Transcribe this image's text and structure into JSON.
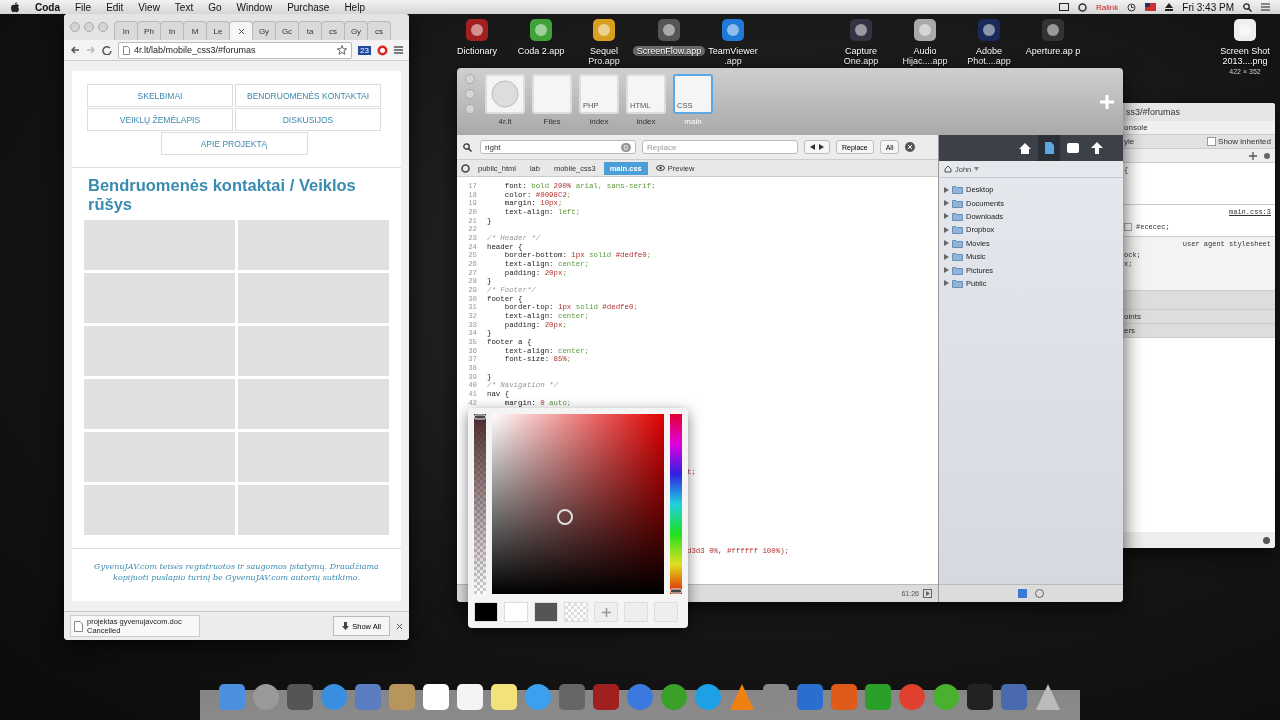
{
  "menubar": {
    "app": "Coda",
    "menus": [
      "File",
      "Edit",
      "View",
      "Text",
      "Go",
      "Window",
      "Purchase",
      "Help"
    ],
    "network": "Ralink",
    "clock": "Fri 3:43 PM"
  },
  "desktop_icons": [
    {
      "label": "Dictionary",
      "selected": false
    },
    {
      "label": "Coda 2.app",
      "selected": false
    },
    {
      "label": "Sequel Pro.app",
      "selected": false
    },
    {
      "label": "ScreenFlow.app",
      "selected": true
    },
    {
      "label": "TeamViewer .app",
      "selected": false
    },
    {
      "label": "Capture One.app",
      "selected": false
    },
    {
      "label": "Audio Hijac....app",
      "selected": false
    },
    {
      "label": "Adobe Phot....app",
      "selected": false
    },
    {
      "label": "Aperture.ap p",
      "selected": false
    },
    {
      "label": "Screen Shot 2013....png",
      "sublabel": "422 × 352",
      "selected": false
    }
  ],
  "browser": {
    "tabs": [
      {
        "label": "In",
        "selected": false
      },
      {
        "label": "Ph",
        "selected": false
      },
      {
        "label": "In",
        "selected": false
      },
      {
        "label": "M",
        "selected": false
      },
      {
        "label": "Le",
        "selected": false
      },
      {
        "selected": true
      },
      {
        "label": "Gy",
        "selected": false
      },
      {
        "label": "Gc",
        "selected": false
      },
      {
        "label": "ta",
        "selected": false
      },
      {
        "label": "cs",
        "selected": false
      },
      {
        "label": "Gy",
        "selected": false
      },
      {
        "label": "cs",
        "selected": false
      }
    ],
    "url": "4r.lt/lab/mobile_css3/#forumas",
    "extension_badge": "23",
    "nav": [
      "SKELBIMAI",
      "BENDRUOMENĖS KONTAKTAI",
      "VEIKLŲ ŽEMĖLAPIS",
      "DISKUSIJOS",
      "APIE PROJEKTĄ"
    ],
    "heading": "Bendruomenės kontaktai / Veiklos rūšys",
    "tiles": [
      {
        "kind": "blank"
      },
      {
        "kind": "blank"
      },
      {
        "kind": "blank"
      },
      {
        "kind": "blank"
      },
      {
        "kind": "blank"
      },
      {
        "kind": "blank"
      },
      {
        "kind": "blank"
      },
      {
        "kind": "blank"
      },
      {
        "kind": "blank"
      },
      {
        "kind": "blank"
      },
      {
        "kind": "blank"
      },
      {
        "kind": "blank"
      }
    ],
    "footer": "GyvenuJAV.com teisės registruotos ir saugomos įstatymų. Draudžiama kopijuoti puslapio turinį be GyvenuJAV.com autorių sutikimo.",
    "download": {
      "file": "projektas gyvenujavcom.doc",
      "status": "Cancelled",
      "show_all": "Show All"
    }
  },
  "coda": {
    "sites": [
      {
        "label": "4r.lt",
        "kind": "site",
        "selected": false
      },
      {
        "label": "Files",
        "kind": "files",
        "selected": false
      },
      {
        "label": "index",
        "kind": "doc",
        "badge": "PHP",
        "selected": false
      },
      {
        "label": "index",
        "kind": "doc",
        "badge": "HTML",
        "selected": false
      },
      {
        "label": "main",
        "kind": "doc",
        "badge": "CSS",
        "selected": true
      }
    ],
    "find": {
      "query": "right",
      "count": "0",
      "replace_placeholder": "Replace",
      "buttons": [
        "Replace",
        "All"
      ]
    },
    "path": [
      {
        "label": "public_html",
        "selected": false
      },
      {
        "label": "lab",
        "selected": false
      },
      {
        "label": "mobile_css3",
        "selected": false
      },
      {
        "label": "main.css",
        "selected": true
      },
      {
        "label": "Preview",
        "kind": "preview",
        "selected": false
      }
    ],
    "code": [
      {
        "num": "17",
        "text": "    font: bold 200% arial, sans-serif;"
      },
      {
        "num": "18",
        "text": "    color: #0098C2;"
      },
      {
        "num": "19",
        "text": "    margin: 10px;"
      },
      {
        "num": "20",
        "text": "    text-align: left;"
      },
      {
        "num": "21",
        "text": "}"
      },
      {
        "num": "22"
      },
      {
        "num": "23",
        "text": "/* Header */"
      },
      {
        "num": "24",
        "text": "header {"
      },
      {
        "num": "25",
        "text": "    border-bottom: 1px solid #dedfe0;"
      },
      {
        "num": "26",
        "text": "    text-align: center;"
      },
      {
        "num": "27",
        "text": "    padding: 20px;"
      },
      {
        "num": "28",
        "text": "}"
      },
      {
        "num": "29",
        "text": "/* Footer*/"
      },
      {
        "num": "30",
        "text": "footer {"
      },
      {
        "num": "31",
        "text": "    border-top: 1px solid #dedfe0;"
      },
      {
        "num": "32",
        "text": "    text-align: center;"
      },
      {
        "num": "33",
        "text": "    padding: 20px;"
      },
      {
        "num": "34",
        "text": "}"
      },
      {
        "num": "35",
        "text": "footer a {"
      },
      {
        "num": "36",
        "text": "    text-align: center;"
      },
      {
        "num": "37",
        "text": "    font-size: 85%;"
      },
      {
        "num": "38"
      },
      {
        "num": "39",
        "text": "}"
      },
      {
        "num": "40",
        "text": "/* Navigation */"
      },
      {
        "num": "41",
        "text": "nav {"
      },
      {
        "num": "42",
        "text": "    margin: 0 auto;"
      }
    ],
    "code_fragments": [
      "t;",
      "d3d3 0%, #ffffff 100%);"
    ],
    "cursor": "61:26",
    "file_tools": [
      {
        "selected": false
      },
      {
        "selected": true
      },
      {
        "selected": false
      },
      {
        "selected": false
      }
    ],
    "user": "John",
    "folders": [
      "Desktop",
      "Documents",
      "Downloads",
      "Dropbox",
      "Movies",
      "Music",
      "Pictures",
      "Public"
    ]
  },
  "inspector": {
    "title": "ss3/#forumas",
    "tab": "onsole",
    "section": "yle",
    "show_inherited": {
      "label": "Show inherited",
      "checked": false
    },
    "brace": "{",
    "source": "main.css:3",
    "value": "#ececec;",
    "value_checked": false,
    "agent": "user agent stylesheet",
    "lines": [
      "ock;",
      "x;"
    ],
    "panels": [
      "oints",
      "ers"
    ]
  },
  "color_picker": {
    "alpha": {
      "level": 1
    },
    "hue": {
      "level": 0
    },
    "swatches": [
      {
        "kind": "color",
        "color": "#000000"
      },
      {
        "kind": "color",
        "color": "#ffffff"
      },
      {
        "kind": "color",
        "color": "#555555"
      },
      {
        "kind": "transparent"
      },
      {
        "kind": "add"
      },
      {
        "kind": "empty"
      },
      {
        "kind": "empty"
      }
    ]
  }
}
